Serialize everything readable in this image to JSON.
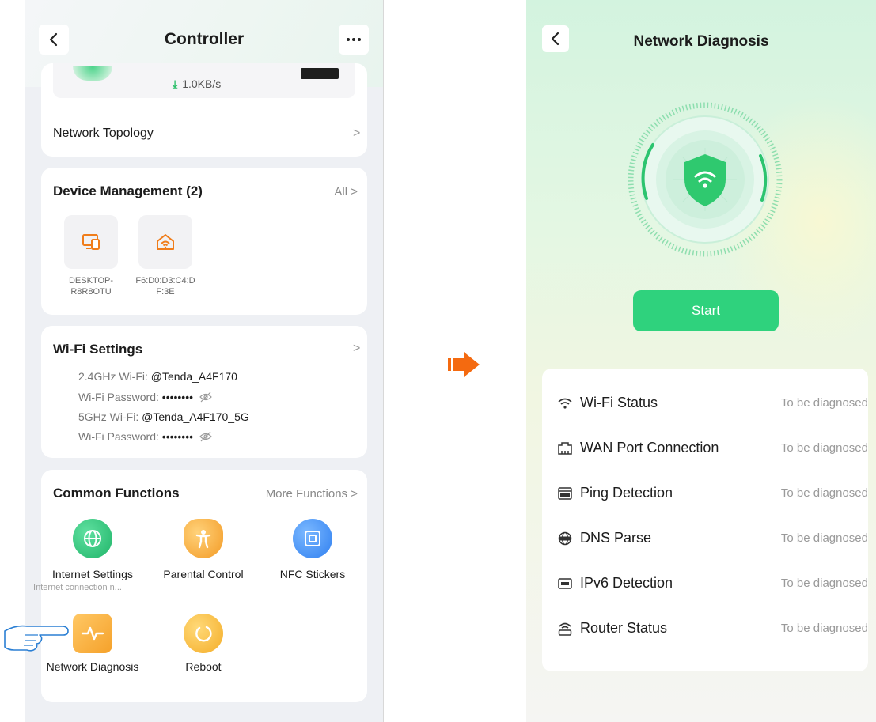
{
  "left_screen": {
    "title": "Controller",
    "back_icon": "chevron-left-icon",
    "more_icon": "more-dots-icon",
    "speed": "1.0KB/s",
    "topology_label": "Network Topology",
    "device_management": {
      "title": "Device Management (2)",
      "all_label": "All >",
      "devices": [
        {
          "name_line1": "DESKTOP-",
          "name_line2": "R8R8OTU",
          "icon": "computer-icon"
        },
        {
          "name_line1": "F6:D0:D3:C4:D",
          "name_line2": "F:3E",
          "icon": "home-wifi-icon"
        }
      ]
    },
    "wifi_settings": {
      "title": "Wi-Fi Settings",
      "lines": [
        {
          "label": "2.4GHz Wi-Fi:",
          "value": "@Tenda_A4F170"
        },
        {
          "label": "Wi-Fi Password:",
          "value": "••••••••"
        },
        {
          "label": "5GHz Wi-Fi:",
          "value": "@Tenda_A4F170_5G"
        },
        {
          "label": "Wi-Fi Password:",
          "value": "••••••••"
        }
      ]
    },
    "common_functions": {
      "title": "Common Functions",
      "more_label": "More Functions >",
      "items": [
        {
          "label": "Internet Settings",
          "sub": "Internet connection n...",
          "icon": "globe-icon",
          "color": "#2fc07a"
        },
        {
          "label": "Parental Control",
          "icon": "child-shield-icon",
          "color": "#f2a93b"
        },
        {
          "label": "NFC Stickers",
          "icon": "nfc-icon",
          "color": "#3b8ff0"
        },
        {
          "label": "Network Diagnosis",
          "icon": "pulse-icon",
          "color": "#f5a623"
        },
        {
          "label": "Reboot",
          "icon": "reboot-icon",
          "color": "#f5b52e"
        }
      ]
    }
  },
  "right_screen": {
    "title": "Network Diagnosis",
    "back_icon": "chevron-left-icon",
    "start_label": "Start",
    "accent": "#2fd27d",
    "items": [
      {
        "name": "Wi-Fi Status",
        "status": "To be diagnosed",
        "icon": "wifi-icon"
      },
      {
        "name": "WAN Port Connection",
        "status": "To be diagnosed",
        "icon": "wan-port-icon"
      },
      {
        "name": "Ping Detection",
        "status": "To be diagnosed",
        "icon": "ping-icon"
      },
      {
        "name": "DNS Parse",
        "status": "To be diagnosed",
        "icon": "dns-icon"
      },
      {
        "name": "IPv6 Detection",
        "status": "To be diagnosed",
        "icon": "ipv6-icon"
      },
      {
        "name": "Router Status",
        "status": "To be diagnosed",
        "icon": "router-icon"
      }
    ]
  }
}
